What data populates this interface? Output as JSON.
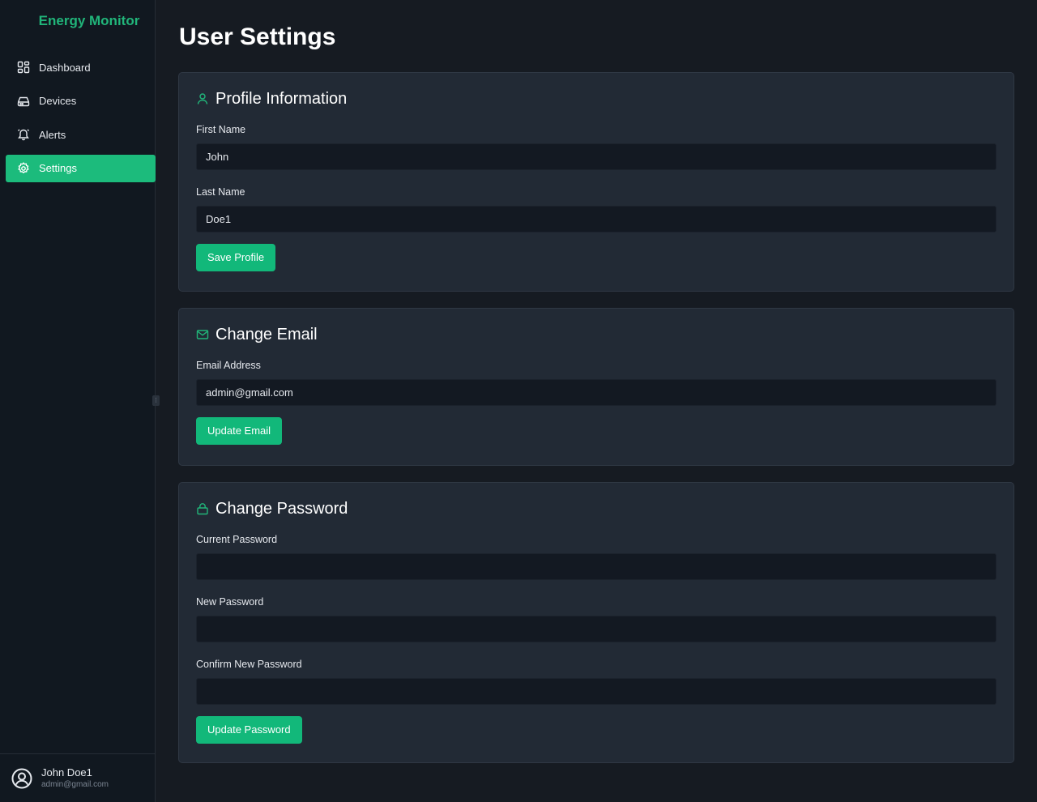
{
  "app": {
    "brand": "Energy Monitor"
  },
  "sidebar": {
    "items": [
      {
        "label": "Dashboard",
        "icon": "dashboard-grid-icon"
      },
      {
        "label": "Devices",
        "icon": "device-drive-icon"
      },
      {
        "label": "Alerts",
        "icon": "bell-icon"
      },
      {
        "label": "Settings",
        "icon": "gear-icon",
        "active": true
      }
    ],
    "user": {
      "name": "John Doe1",
      "email": "admin@gmail.com",
      "icon": "user-circle-icon"
    }
  },
  "page": {
    "title": "User Settings"
  },
  "profile": {
    "title": "Profile Information",
    "icon": "user-icon",
    "first_name_label": "First Name",
    "first_name_value": "John",
    "last_name_label": "Last Name",
    "last_name_value": "Doe1",
    "save_label": "Save Profile"
  },
  "email": {
    "title": "Change Email",
    "icon": "mail-icon",
    "address_label": "Email Address",
    "address_value": "admin@gmail.com",
    "update_label": "Update Email"
  },
  "password": {
    "title": "Change Password",
    "icon": "lock-icon",
    "current_label": "Current Password",
    "current_value": "",
    "new_label": "New Password",
    "new_value": "",
    "confirm_label": "Confirm New Password",
    "confirm_value": "",
    "update_label": "Update Password"
  },
  "colors": {
    "accent": "#1cbb7c",
    "brand": "#21b57a",
    "background": "#161b22",
    "card": "#222a35"
  }
}
